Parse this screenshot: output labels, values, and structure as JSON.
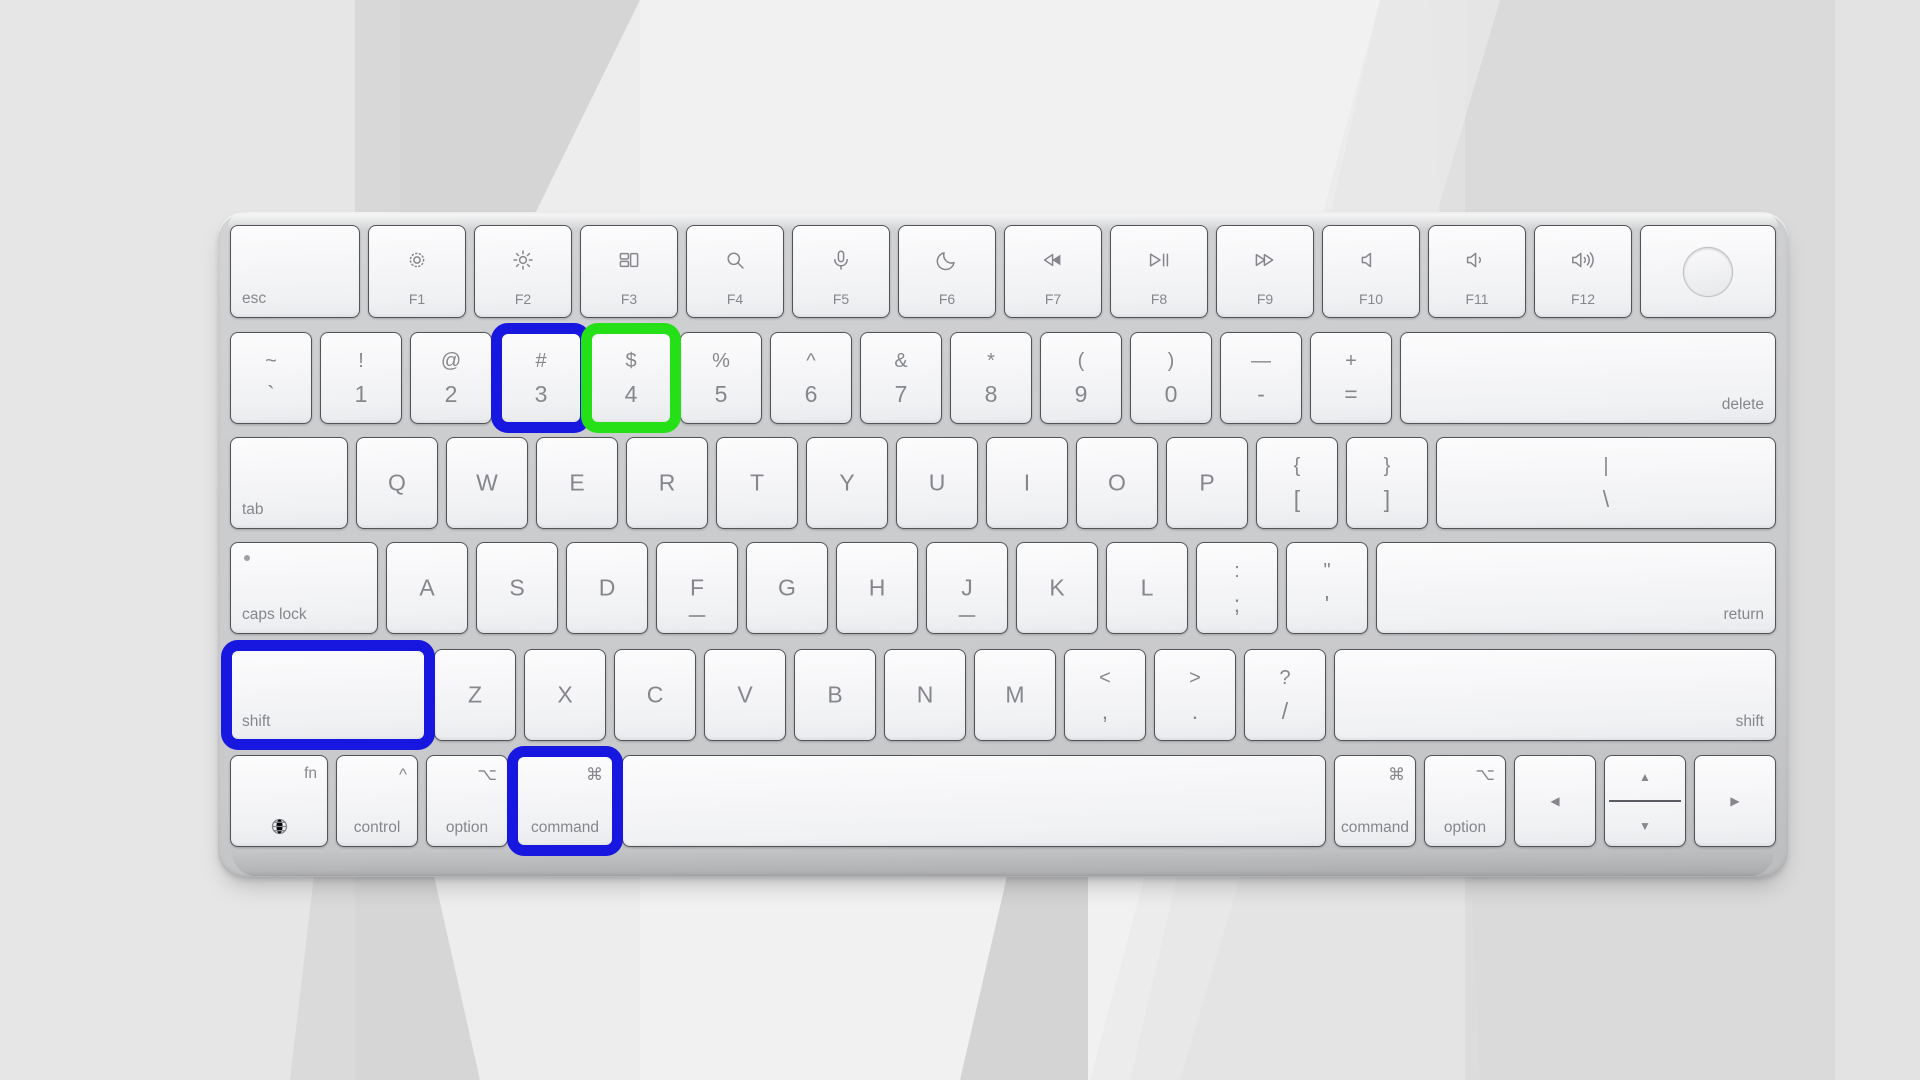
{
  "scene": {
    "title": "Apple Magic Keyboard with Touch ID",
    "description": "Magic Keyboard illustration with Shift, Command, 3 highlighted in blue and 4 highlighted in green",
    "background_colors": [
      "#e8e8e8",
      "#f2f2f2",
      "#dcdcdc",
      "#d4d4d4",
      "#ededed"
    ],
    "highlight_colors": {
      "blue": "#1717e0",
      "green": "#25e017"
    },
    "key_face_color": "#f4f5f7",
    "key_border_color": "#53545a",
    "legend_color": "#86878c",
    "chassis_color": "#cccdcf"
  },
  "highlights": [
    {
      "target": "key-3",
      "color": "blue",
      "name": "highlight-ring-3"
    },
    {
      "target": "key-4",
      "color": "green",
      "name": "highlight-ring-4"
    },
    {
      "target": "key-shift-left",
      "color": "blue",
      "name": "highlight-ring-shift"
    },
    {
      "target": "key-command-left",
      "color": "blue",
      "name": "highlight-ring-command"
    }
  ],
  "rows": {
    "function_row": [
      {
        "id": "esc",
        "label": "esc",
        "legend_style": "bottom-left",
        "name": "key-esc"
      },
      {
        "id": "f1",
        "fkey": "F1",
        "icon": "brightness-down-icon",
        "name": "key-f1"
      },
      {
        "id": "f2",
        "fkey": "F2",
        "icon": "brightness-up-icon",
        "name": "key-f2"
      },
      {
        "id": "f3",
        "fkey": "F3",
        "icon": "mission-control-icon",
        "name": "key-f3"
      },
      {
        "id": "f4",
        "fkey": "F4",
        "icon": "spotlight-search-icon",
        "name": "key-f4"
      },
      {
        "id": "f5",
        "fkey": "F5",
        "icon": "dictation-mic-icon",
        "name": "key-f5"
      },
      {
        "id": "f6",
        "fkey": "F6",
        "icon": "do-not-disturb-moon-icon",
        "name": "key-f6"
      },
      {
        "id": "f7",
        "fkey": "F7",
        "icon": "rewind-icon",
        "name": "key-f7"
      },
      {
        "id": "f8",
        "fkey": "F8",
        "icon": "play-pause-icon",
        "name": "key-f8"
      },
      {
        "id": "f9",
        "fkey": "F9",
        "icon": "fast-forward-icon",
        "name": "key-f9"
      },
      {
        "id": "f10",
        "fkey": "F10",
        "icon": "mute-icon",
        "name": "key-f10"
      },
      {
        "id": "f11",
        "fkey": "F11",
        "icon": "volume-down-icon",
        "name": "key-f11"
      },
      {
        "id": "f12",
        "fkey": "F12",
        "icon": "volume-up-icon",
        "name": "key-f12"
      },
      {
        "id": "touchid",
        "label": "",
        "icon": "touch-id-icon",
        "name": "key-touch-id"
      }
    ],
    "number_row": [
      {
        "id": "tilde",
        "upper": "~",
        "lower": "`",
        "name": "key-grave"
      },
      {
        "id": "1",
        "upper": "!",
        "lower": "1",
        "name": "key-1"
      },
      {
        "id": "2",
        "upper": "@",
        "lower": "2",
        "name": "key-2"
      },
      {
        "id": "3",
        "upper": "#",
        "lower": "3",
        "name": "key-3"
      },
      {
        "id": "4",
        "upper": "$",
        "lower": "4",
        "name": "key-4"
      },
      {
        "id": "5",
        "upper": "%",
        "lower": "5",
        "name": "key-5"
      },
      {
        "id": "6",
        "upper": "^",
        "lower": "6",
        "name": "key-6"
      },
      {
        "id": "7",
        "upper": "&",
        "lower": "7",
        "name": "key-7"
      },
      {
        "id": "8",
        "upper": "*",
        "lower": "8",
        "name": "key-8"
      },
      {
        "id": "9",
        "upper": "(",
        "lower": "9",
        "name": "key-9"
      },
      {
        "id": "0",
        "upper": ")",
        "lower": "0",
        "name": "key-0"
      },
      {
        "id": "minus",
        "upper": "—",
        "lower": "-",
        "name": "key-minus"
      },
      {
        "id": "equal",
        "upper": "+",
        "lower": "=",
        "name": "key-equal"
      },
      {
        "id": "delete",
        "label": "delete",
        "legend_style": "bottom-right",
        "name": "key-delete"
      }
    ],
    "top_letter_row": [
      {
        "id": "tab",
        "label": "tab",
        "legend_style": "bottom-left",
        "name": "key-tab"
      },
      {
        "id": "q",
        "center": "Q",
        "name": "key-q"
      },
      {
        "id": "w",
        "center": "W",
        "name": "key-w"
      },
      {
        "id": "e",
        "center": "E",
        "name": "key-e"
      },
      {
        "id": "r",
        "center": "R",
        "name": "key-r"
      },
      {
        "id": "t",
        "center": "T",
        "name": "key-t"
      },
      {
        "id": "y",
        "center": "Y",
        "name": "key-y"
      },
      {
        "id": "u",
        "center": "U",
        "name": "key-u"
      },
      {
        "id": "i",
        "center": "I",
        "name": "key-i"
      },
      {
        "id": "o",
        "center": "O",
        "name": "key-o"
      },
      {
        "id": "p",
        "center": "P",
        "name": "key-p"
      },
      {
        "id": "lbracket",
        "upper": "{",
        "lower": "[",
        "name": "key-left-bracket"
      },
      {
        "id": "rbracket",
        "upper": "}",
        "lower": "]",
        "name": "key-right-bracket"
      },
      {
        "id": "backslash",
        "upper": "|",
        "lower": "\\",
        "name": "key-backslash"
      }
    ],
    "home_row": [
      {
        "id": "capslock",
        "label": "caps lock",
        "legend_style": "bottom-left",
        "indicator": true,
        "name": "key-caps-lock"
      },
      {
        "id": "a",
        "center": "A",
        "name": "key-a"
      },
      {
        "id": "s",
        "center": "S",
        "name": "key-s"
      },
      {
        "id": "d",
        "center": "D",
        "name": "key-d"
      },
      {
        "id": "f",
        "center": "F",
        "homing": true,
        "name": "key-f"
      },
      {
        "id": "g",
        "center": "G",
        "name": "key-g"
      },
      {
        "id": "h",
        "center": "H",
        "name": "key-h"
      },
      {
        "id": "j",
        "center": "J",
        "homing": true,
        "name": "key-j"
      },
      {
        "id": "k",
        "center": "K",
        "name": "key-k"
      },
      {
        "id": "l",
        "center": "L",
        "name": "key-l"
      },
      {
        "id": "semicolon",
        "upper": ":",
        "lower": ";",
        "name": "key-semicolon"
      },
      {
        "id": "quote",
        "upper": "\"",
        "lower": "'",
        "name": "key-quote"
      },
      {
        "id": "return",
        "label": "return",
        "legend_style": "bottom-right",
        "name": "key-return"
      }
    ],
    "shift_row": [
      {
        "id": "shift-left",
        "label": "shift",
        "legend_style": "bottom-left",
        "name": "key-shift-left"
      },
      {
        "id": "z",
        "center": "Z",
        "name": "key-z"
      },
      {
        "id": "x",
        "center": "X",
        "name": "key-x"
      },
      {
        "id": "c",
        "center": "C",
        "name": "key-c"
      },
      {
        "id": "v",
        "center": "V",
        "name": "key-v"
      },
      {
        "id": "b",
        "center": "B",
        "name": "key-b"
      },
      {
        "id": "n",
        "center": "N",
        "name": "key-n"
      },
      {
        "id": "m",
        "center": "M",
        "name": "key-m"
      },
      {
        "id": "comma",
        "upper": "<",
        "lower": ",",
        "name": "key-comma"
      },
      {
        "id": "period",
        "upper": ">",
        "lower": ".",
        "name": "key-period"
      },
      {
        "id": "slash",
        "upper": "?",
        "lower": "/",
        "name": "key-slash"
      },
      {
        "id": "shift-right",
        "label": "shift",
        "legend_style": "bottom-right",
        "name": "key-shift-right"
      }
    ],
    "bottom_row": [
      {
        "id": "fn",
        "top": "fn",
        "glyph_bottom": "globe-icon",
        "name": "key-fn"
      },
      {
        "id": "control",
        "label": "control",
        "glyph": "^",
        "name": "key-control"
      },
      {
        "id": "option-left",
        "label": "option",
        "glyph": "⌥",
        "name": "key-option-left"
      },
      {
        "id": "command-left",
        "label": "command",
        "glyph": "⌘",
        "name": "key-command-left"
      },
      {
        "id": "space",
        "label": "",
        "name": "key-space"
      },
      {
        "id": "command-right",
        "label": "command",
        "glyph": "⌘",
        "name": "key-command-right"
      },
      {
        "id": "option-right",
        "label": "option",
        "glyph": "⌥",
        "name": "key-option-right"
      },
      {
        "id": "arrow-left",
        "glyph": "◀",
        "name": "key-arrow-left"
      },
      {
        "id": "arrow-updown",
        "glyph_up": "▲",
        "glyph_down": "▼",
        "name": "key-arrow-up-down"
      },
      {
        "id": "arrow-right",
        "glyph": "▶",
        "name": "key-arrow-right"
      }
    ]
  }
}
